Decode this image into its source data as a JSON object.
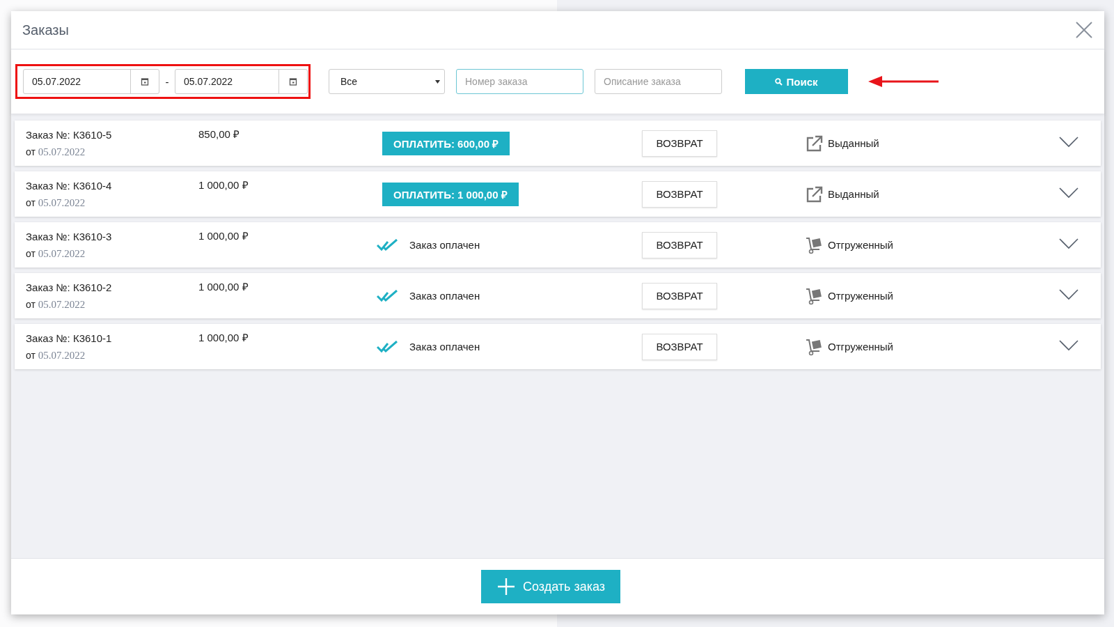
{
  "window": {
    "title": "Заказы"
  },
  "filters": {
    "date_from": "05.07.2022",
    "separator": "-",
    "date_to": "05.07.2022",
    "status": "Все",
    "order_number": {
      "placeholder": "Номер заказа"
    },
    "order_description": {
      "placeholder": "Описание заказа"
    },
    "search_button": "Поиск"
  },
  "orders": [
    {
      "number": "Заказ №: К3610-5",
      "date_prefix": "от",
      "date": "05.07.2022",
      "amount": "850,00 ₽",
      "payment": {
        "kind": "pay",
        "label": "ОПЛАТИТЬ: 600,00 ₽"
      },
      "return_button": "ВОЗВРАТ",
      "status": {
        "kind": "issued",
        "label": "Выданный"
      }
    },
    {
      "number": "Заказ №: К3610-4",
      "date_prefix": "от",
      "date": "05.07.2022",
      "amount": "1 000,00 ₽",
      "payment": {
        "kind": "pay",
        "label": "ОПЛАТИТЬ: 1 000,00 ₽"
      },
      "return_button": "ВОЗВРАТ",
      "status": {
        "kind": "issued",
        "label": "Выданный"
      }
    },
    {
      "number": "Заказ №: К3610-3",
      "date_prefix": "от",
      "date": "05.07.2022",
      "amount": "1 000,00 ₽",
      "payment": {
        "kind": "paid",
        "label": "Заказ оплачен"
      },
      "return_button": "ВОЗВРАТ",
      "status": {
        "kind": "shipped",
        "label": "Отгруженный"
      }
    },
    {
      "number": "Заказ №: К3610-2",
      "date_prefix": "от",
      "date": "05.07.2022",
      "amount": "1 000,00 ₽",
      "payment": {
        "kind": "paid",
        "label": "Заказ оплачен"
      },
      "return_button": "ВОЗВРАТ",
      "status": {
        "kind": "shipped",
        "label": "Отгруженный"
      }
    },
    {
      "number": "Заказ №: К3610-1",
      "date_prefix": "от",
      "date": "05.07.2022",
      "amount": "1 000,00 ₽",
      "payment": {
        "kind": "paid",
        "label": "Заказ оплачен"
      },
      "return_button": "ВОЗВРАТ",
      "status": {
        "kind": "shipped",
        "label": "Отгруженный"
      }
    }
  ],
  "footer": {
    "create_button": "Создать заказ"
  }
}
